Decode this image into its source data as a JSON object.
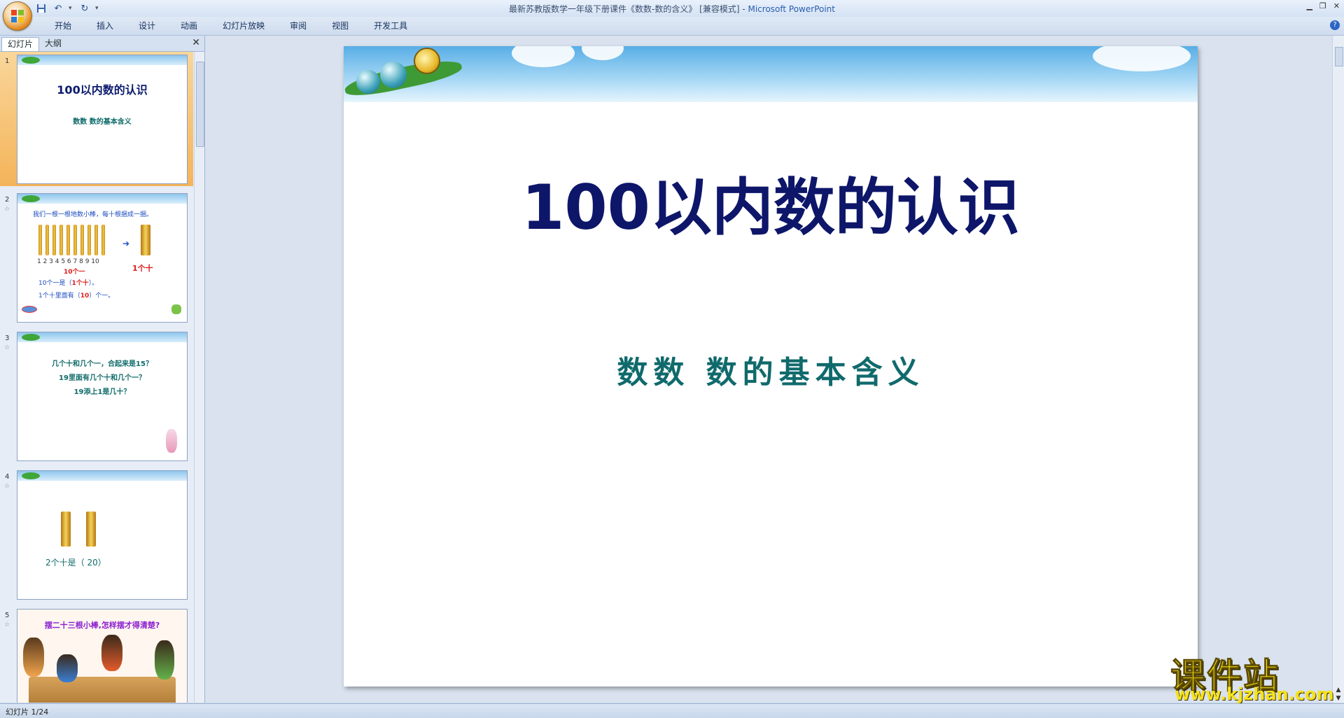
{
  "window": {
    "title_doc": "最新苏教版数学一年级下册课件《数数-数的含义》 [兼容模式]",
    "title_sep": " - ",
    "title_app": "Microsoft PowerPoint"
  },
  "ribbon": {
    "tabs": [
      "开始",
      "插入",
      "设计",
      "动画",
      "幻灯片放映",
      "审阅",
      "视图",
      "开发工具"
    ]
  },
  "panel": {
    "tab_slides": "幻灯片",
    "tab_outline": "大纲"
  },
  "thumbnails": [
    {
      "num": "1",
      "title": "100以内数的认识",
      "subtitle": "数数  数的基本含义"
    },
    {
      "num": "2",
      "line1": "我们一根一根地数小棒，每十根捆成一捆。",
      "numbers": "1 2 3 4 5 6 7 8 9 10",
      "ten_ones": "10个一",
      "one_ten": "1个十",
      "line2a": "10个一是（",
      "line2b": "1个十",
      "line2c": "）。",
      "line3a": "1个十里面有（",
      "line3b": "10",
      "line3c": "）个一。"
    },
    {
      "num": "3",
      "q1": "几个十和几个一，合起来是15？",
      "q2": "19里面有几个十和几个一？",
      "q3": "19添上1是几十？"
    },
    {
      "num": "4",
      "text": "2个十是（ 20）"
    },
    {
      "num": "5",
      "text": "摆二十三根小棒,怎样摆才得清楚?"
    }
  ],
  "slide": {
    "title": "100以内数的认识",
    "subtitle": "数数  数的基本含义"
  },
  "status": {
    "slide_counter": "幻灯片 1/24"
  },
  "watermark": {
    "brand": "课件站",
    "url": "www.kjzhan.com"
  }
}
